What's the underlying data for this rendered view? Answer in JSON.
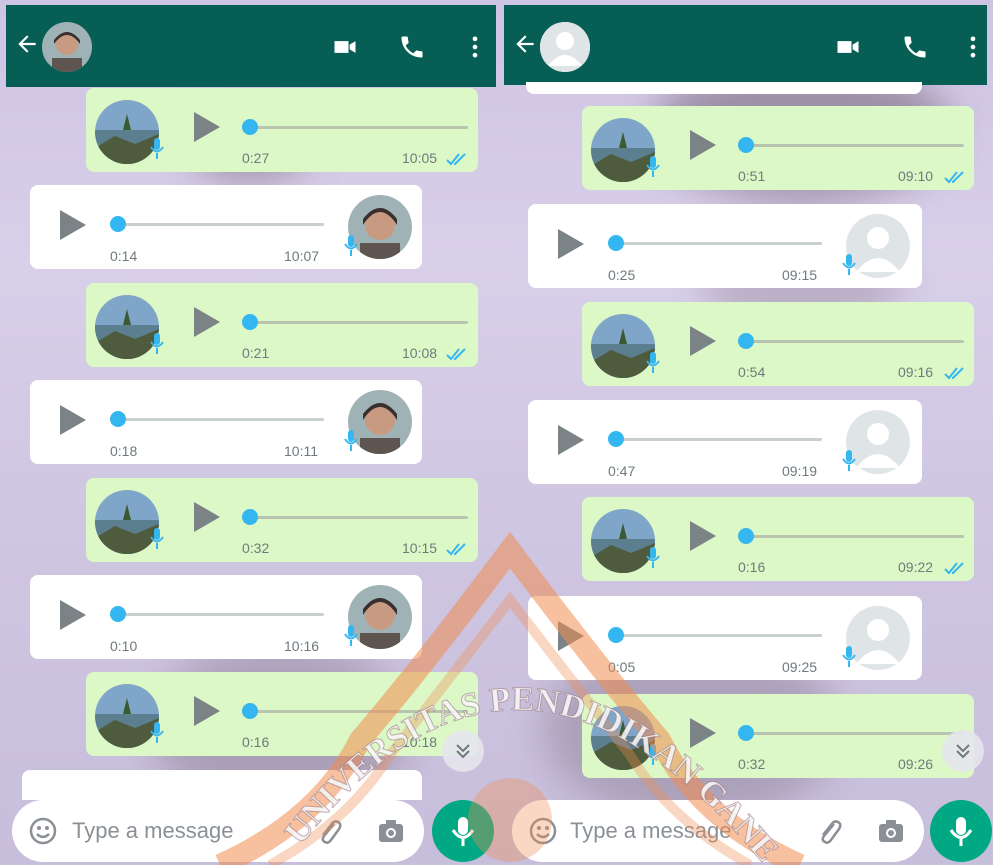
{
  "left_chat": {
    "messages": [
      {
        "direction": "out",
        "duration": "0:27",
        "time": "10:05",
        "read": true
      },
      {
        "direction": "in",
        "duration": "0:14",
        "time": "10:07"
      },
      {
        "direction": "out",
        "duration": "0:21",
        "time": "10:08",
        "read": true
      },
      {
        "direction": "in",
        "duration": "0:18",
        "time": "10:11"
      },
      {
        "direction": "out",
        "duration": "0:32",
        "time": "10:15",
        "read": true
      },
      {
        "direction": "in",
        "duration": "0:10",
        "time": "10:16"
      },
      {
        "direction": "out",
        "duration": "0:16",
        "time": "10:18",
        "read": true
      }
    ],
    "input_placeholder": "Type a message"
  },
  "right_chat": {
    "messages": [
      {
        "direction": "out",
        "duration": "0:51",
        "time": "09:10",
        "read": true
      },
      {
        "direction": "in",
        "duration": "0:25",
        "time": "09:15"
      },
      {
        "direction": "out",
        "duration": "0:54",
        "time": "09:16",
        "read": true
      },
      {
        "direction": "in",
        "duration": "0:47",
        "time": "09:19"
      },
      {
        "direction": "out",
        "duration": "0:16",
        "time": "09:22",
        "read": true
      },
      {
        "direction": "in",
        "duration": "0:05",
        "time": "09:25"
      },
      {
        "direction": "out",
        "duration": "0:32",
        "time": "09:26",
        "read": true
      }
    ],
    "input_placeholder": "Type a message"
  },
  "watermark": {
    "text": "UNIVERSITAS PENDIDIKAN GANESHA"
  },
  "colors": {
    "header": "#075e54",
    "outgoing_bubble": "#dcf8c6",
    "incoming_bubble": "#ffffff",
    "progress_knob": "#34b7f1",
    "read_ticks": "#34b7f1",
    "mic_button": "#00a884"
  },
  "icons": [
    "back-arrow-icon",
    "video-call-icon",
    "voice-call-icon",
    "more-options-icon",
    "play-icon",
    "mic-badge-icon",
    "double-check-icon",
    "emoji-icon",
    "attach-icon",
    "camera-icon",
    "mic-icon",
    "scroll-down-icon",
    "default-avatar-icon"
  ]
}
